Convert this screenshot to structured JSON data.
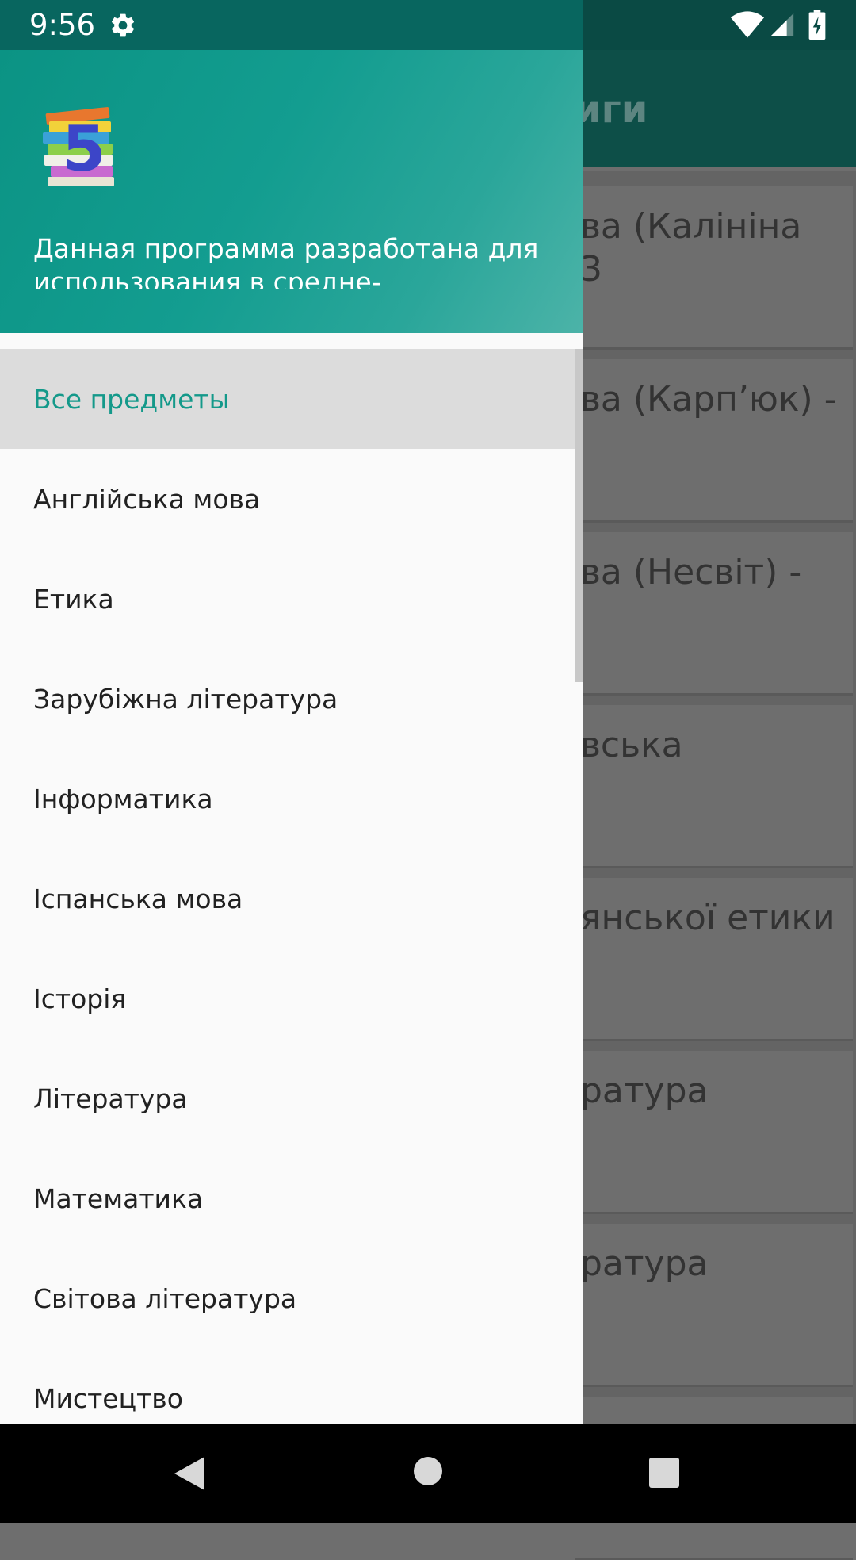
{
  "status_bar": {
    "time": "9:56"
  },
  "background_app": {
    "title": "иги",
    "cards": [
      {
        "line1": "ва (Калініна",
        "line2": "3"
      },
      {
        "line1": "ва (Карп’юк) -",
        "line2": ""
      },
      {
        "line1": "ва (Несвіт) -",
        "line2": ""
      },
      {
        "line1": "вська",
        "line2": ""
      },
      {
        "line1": "янської етики",
        "line2": ""
      },
      {
        "line1": "ратура",
        "line2": ""
      },
      {
        "line1": "ратура",
        "line2": ""
      }
    ]
  },
  "drawer": {
    "header_text": "Данная программа разработана для использования в средне-",
    "items": [
      {
        "label": "Все предметы",
        "selected": true
      },
      {
        "label": "Англійська мова"
      },
      {
        "label": "Етика"
      },
      {
        "label": "Зарубіжна література"
      },
      {
        "label": "Інформатика"
      },
      {
        "label": "Іспанська мова"
      },
      {
        "label": "Історія"
      },
      {
        "label": "Література"
      },
      {
        "label": "Математика"
      },
      {
        "label": "Світова література"
      },
      {
        "label": "Мистецтво"
      }
    ]
  },
  "colors": {
    "accent": "#14998a",
    "header_start": "#0b9384",
    "header_end": "#4cb3a8"
  },
  "icons": {
    "settings": "gear-icon",
    "wifi": "wifi-icon",
    "signal": "signal-icon",
    "battery": "battery-icon",
    "back": "back-icon",
    "home": "home-icon",
    "recents": "recents-icon"
  }
}
